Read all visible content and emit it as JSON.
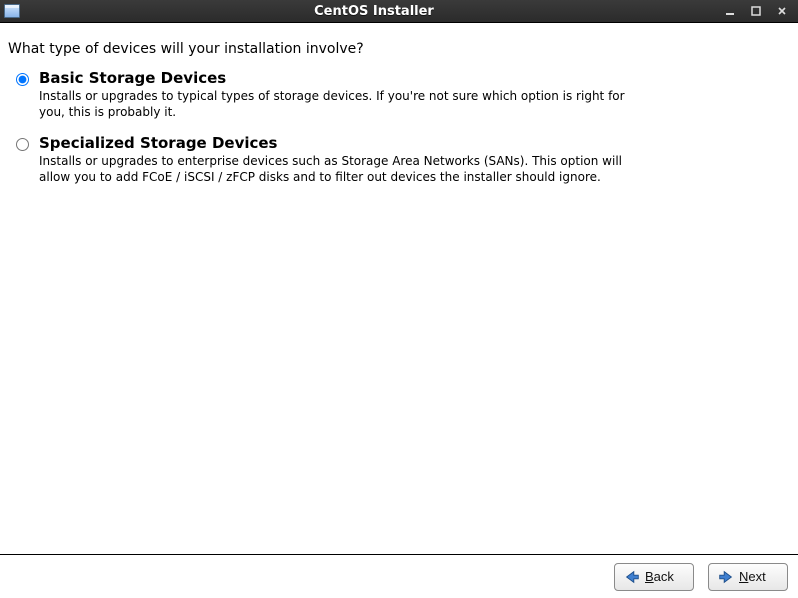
{
  "window": {
    "title": "CentOS Installer"
  },
  "page": {
    "question": "What type of devices will your installation involve?"
  },
  "options": {
    "basic": {
      "title": "Basic Storage Devices",
      "desc": "Installs or upgrades to typical types of storage devices.  If you're not sure which option is right for you, this is probably it.",
      "selected": true
    },
    "specialized": {
      "title": "Specialized Storage Devices",
      "desc": "Installs or upgrades to enterprise devices such as Storage Area Networks (SANs). This option will allow you to add FCoE / iSCSI / zFCP disks and to filter out devices the installer should ignore.",
      "selected": false
    }
  },
  "footer": {
    "back_mnemonic": "B",
    "back_rest": "ack",
    "next_mnemonic": "N",
    "next_rest": "ext"
  }
}
